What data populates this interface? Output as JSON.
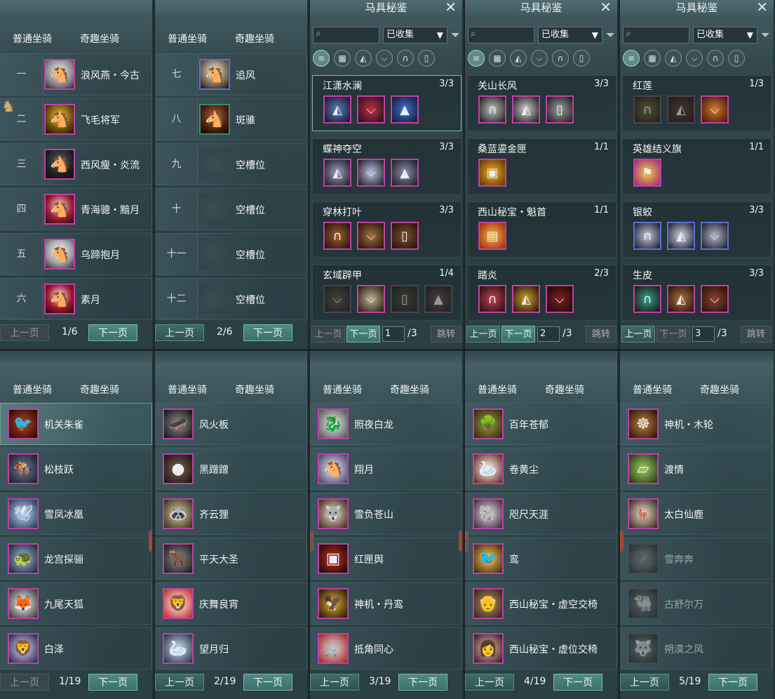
{
  "common": {
    "tab_normal": "普通坐骑",
    "tab_fun": "奇趣坐骑",
    "prev": "上一页",
    "next": "下一页"
  },
  "top_normal": [
    {
      "page": "1/6",
      "rows": [
        {
          "num": "一",
          "name": "浪风燕・今古",
          "icon": "white-horse-icon"
        },
        {
          "num": "二",
          "name": "飞毛将军",
          "icon": "golden-horse-icon"
        },
        {
          "num": "三",
          "name": "西风瘦・炎流",
          "icon": "black-horse-icon"
        },
        {
          "num": "四",
          "name": "青海骢・黯月",
          "icon": "armored-horse-icon"
        },
        {
          "num": "五",
          "name": "乌蹄抱月",
          "icon": "white-horse-icon"
        },
        {
          "num": "六",
          "name": "素月",
          "icon": "armored-horse-icon"
        }
      ]
    },
    {
      "page": "2/6",
      "rows": [
        {
          "num": "七",
          "name": "追风",
          "icon": "white-horse-icon",
          "blue": true
        },
        {
          "num": "八",
          "name": "斑骓",
          "icon": "brown-horse-icon"
        },
        {
          "num": "九",
          "name": "空槽位",
          "empty": true
        },
        {
          "num": "十",
          "name": "空槽位",
          "empty": true
        },
        {
          "num": "十一",
          "name": "空槽位",
          "empty": true
        },
        {
          "num": "十二",
          "name": "空槽位",
          "empty": true
        }
      ]
    }
  ],
  "catalog": {
    "title": "马具秘鉴",
    "filter": "已收集",
    "jump": "跳转",
    "total": "/3",
    "pages": [
      {
        "page": "1",
        "sets": [
          {
            "name": "江潇水澜",
            "count": "3/3",
            "pieces": 3
          },
          {
            "name": "蝶神夺空",
            "count": "3/3",
            "pieces": 3
          },
          {
            "name": "穿林打叶",
            "count": "3/3",
            "pieces": 3
          },
          {
            "name": "玄域辟甲",
            "count": "1/4",
            "pieces": 4
          }
        ]
      },
      {
        "page": "2",
        "sets": [
          {
            "name": "关山长风",
            "count": "3/3",
            "pieces": 3
          },
          {
            "name": "桑蓝鎏金匣",
            "count": "1/1",
            "pieces": 1
          },
          {
            "name": "西山秘宝・魁首",
            "count": "1/1",
            "pieces": 1
          },
          {
            "name": "踏炎",
            "count": "2/3",
            "pieces": 3
          }
        ]
      },
      {
        "page": "3",
        "sets": [
          {
            "name": "红莲",
            "count": "1/3",
            "pieces": 3
          },
          {
            "name": "英雄结义旗",
            "count": "1/1",
            "pieces": 1
          },
          {
            "name": "银蛟",
            "count": "3/3",
            "pieces": 3
          },
          {
            "name": "生皮",
            "count": "3/3",
            "pieces": 3
          }
        ]
      }
    ]
  },
  "bottom_fun": [
    {
      "page": "1/19",
      "rows": [
        "机关朱雀",
        "松枝跃",
        "雪凤冰凰",
        "龙宫探骊",
        "九尾天狐",
        "白泽"
      ]
    },
    {
      "page": "2/19",
      "rows": [
        "风火板",
        "黑蹭蹭",
        "齐云狸",
        "平天大圣",
        "庆舞良宵",
        "望月归"
      ]
    },
    {
      "page": "3/19",
      "rows": [
        "照夜白龙",
        "翔月",
        "雪负苍山",
        "红匣舆",
        "神机・丹鸾",
        "抵角同心"
      ]
    },
    {
      "page": "4/19",
      "rows": [
        "百年苍郁",
        "卷黄尘",
        "咫尺天涯",
        "鸾",
        "西山秘宝・虚空交椅",
        "西山秘宝・虚位交椅"
      ]
    },
    {
      "page": "5/19",
      "rows": [
        "神机・木轮",
        "渡情",
        "太白仙鹿",
        "雪奔奔",
        "古舒尔万",
        "朔漠之风"
      ]
    }
  ]
}
